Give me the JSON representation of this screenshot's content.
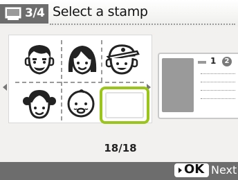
{
  "header": {
    "step_icon": "print-screen-icon",
    "step": "3/4",
    "title": "Select a stamp"
  },
  "stamps": [
    {
      "name": "stamp-man",
      "icon": "man-face-icon"
    },
    {
      "name": "stamp-woman",
      "icon": "woman-face-icon"
    },
    {
      "name": "stamp-boy-cap",
      "icon": "boy-cap-face-icon"
    },
    {
      "name": "stamp-girl",
      "icon": "girl-face-icon"
    },
    {
      "name": "stamp-baby",
      "icon": "baby-face-icon"
    },
    {
      "name": "stamp-blank",
      "icon": "blank-stamp",
      "selected": true
    }
  ],
  "preview": {
    "count": "1",
    "badge": "2"
  },
  "counter": "18/18",
  "footer": {
    "ok_label": "OK",
    "next_label": "Next"
  },
  "colors": {
    "accent": "#9bc51d",
    "bar": "#6d6d6d",
    "background": "#f3f1ef"
  }
}
